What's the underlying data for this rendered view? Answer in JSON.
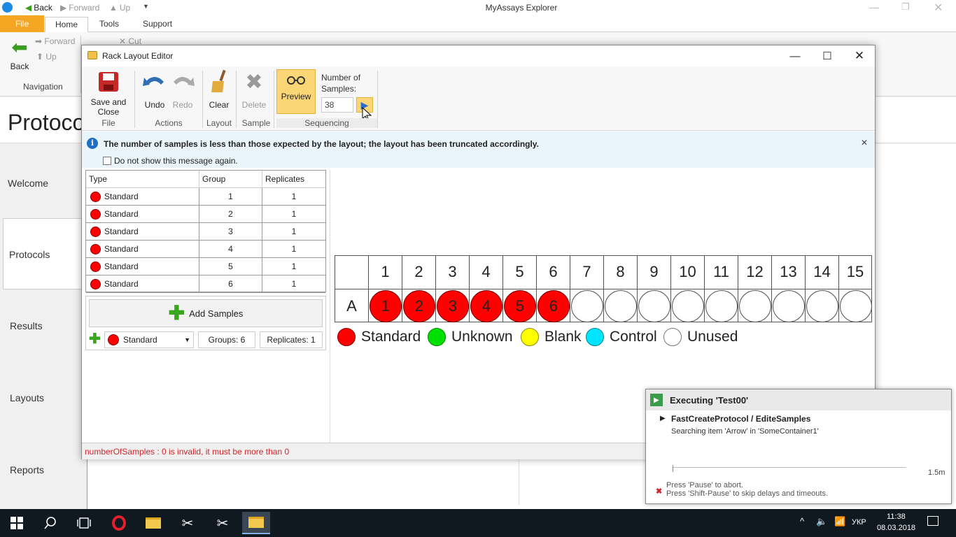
{
  "main_window": {
    "title": "MyAssays Explorer",
    "quick_access": {
      "back": "Back",
      "forward": "Forward",
      "up": "Up"
    },
    "tabs": [
      "File",
      "Home",
      "Tools",
      "Support"
    ],
    "ribbon": {
      "back": "Back",
      "forward": "Forward",
      "up": "Up",
      "cut": "Cut",
      "navigation_group": "Navigation"
    },
    "header_title": "Protoco",
    "nav_items": [
      "Welcome",
      "Protocols",
      "Results",
      "Layouts",
      "Reports"
    ]
  },
  "dialog": {
    "title": "Rack Layout Editor",
    "ribbon": {
      "save_close": "Save and Close",
      "file_group": "File",
      "undo": "Undo",
      "redo": "Redo",
      "actions_group": "Actions",
      "clear": "Clear",
      "layout_group": "Layout",
      "delete": "Delete",
      "sample_group": "Sample",
      "preview": "Preview",
      "number_of_samples_label": "Number of Samples:",
      "number_of_samples_value": "38",
      "sequencing_group": "Sequencing"
    },
    "info_message": "The number of samples is less than those expected by the layout; the layout has been truncated accordingly.",
    "do_not_show": "Do not show this message again.",
    "table": {
      "headers": [
        "Type",
        "Group",
        "Replicates"
      ],
      "rows": [
        {
          "type": "Standard",
          "group": "1",
          "replicates": "1"
        },
        {
          "type": "Standard",
          "group": "2",
          "replicates": "1"
        },
        {
          "type": "Standard",
          "group": "3",
          "replicates": "1"
        },
        {
          "type": "Standard",
          "group": "4",
          "replicates": "1"
        },
        {
          "type": "Standard",
          "group": "5",
          "replicates": "1"
        },
        {
          "type": "Standard",
          "group": "6",
          "replicates": "1"
        }
      ]
    },
    "add_samples": "Add Samples",
    "type_select": "Standard",
    "groups": "Groups: 6",
    "replicates": "Replicates: 1",
    "plate": {
      "row_label": "A",
      "columns": [
        "1",
        "2",
        "3",
        "4",
        "5",
        "6",
        "7",
        "8",
        "9",
        "10",
        "11",
        "12",
        "13",
        "14",
        "15"
      ],
      "wells": [
        "1",
        "2",
        "3",
        "4",
        "5",
        "6",
        "",
        "",
        "",
        "",
        "",
        "",
        "",
        "",
        ""
      ],
      "well_types": [
        "standard",
        "standard",
        "standard",
        "standard",
        "standard",
        "standard",
        "unused",
        "unused",
        "unused",
        "unused",
        "unused",
        "unused",
        "unused",
        "unused",
        "unused"
      ]
    },
    "legend": [
      {
        "label": "Standard",
        "color": "#ff0000"
      },
      {
        "label": "Unknown",
        "color": "#00e000"
      },
      {
        "label": "Blank",
        "color": "#ffff00"
      },
      {
        "label": "Control",
        "color": "#00e5ff"
      },
      {
        "label": "Unused",
        "color": "#ffffff"
      }
    ],
    "status_error": "numberOfSamples : 0 is invalid, it must be more than 0"
  },
  "exec_panel": {
    "title": "Executing 'Test00'",
    "step": "FastCreateProtocol / EditeSamples",
    "detail": "Searching item 'Arrow' in 'SomeContainer1'",
    "time": "1.5m",
    "hint1": "Press 'Pause' to abort.",
    "hint2": "Press 'Shift-Pause' to skip delays and timeouts."
  },
  "taskbar": {
    "lang": "УКР",
    "time": "11:38",
    "date": "08.03.2018"
  },
  "colors": {
    "accent_file": "#f5a623",
    "standard": "#ff0000",
    "error_text": "#d0242b",
    "info_bg": "#eaf5fb"
  }
}
